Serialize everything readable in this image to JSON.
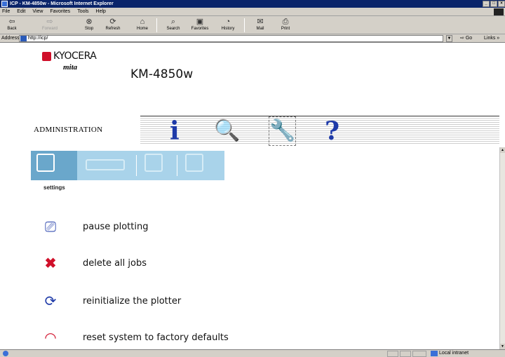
{
  "window": {
    "title": "ICP - KM-4850w - Microsoft Internet Explorer"
  },
  "menu": [
    "File",
    "Edit",
    "View",
    "Favorites",
    "Tools",
    "Help"
  ],
  "toolbar": {
    "back": "Back",
    "forward": "Forward",
    "stop": "Stop",
    "refresh": "Refresh",
    "home": "Home",
    "search": "Search",
    "favorites": "Favorites",
    "history": "History",
    "mail": "Mail",
    "print": "Print"
  },
  "address": {
    "label": "Address",
    "url": "http://icp/",
    "go": "Go",
    "links": "Links"
  },
  "brand": {
    "name": "KYOCERA",
    "sub": "mita",
    "model": "KM-4850w"
  },
  "section": {
    "title": "ADMINISTRATION"
  },
  "nav_icons": [
    {
      "glyph": "i",
      "name": "info-icon"
    },
    {
      "glyph": "🔍",
      "name": "search-tool-icon"
    },
    {
      "glyph": "🔧",
      "name": "wrench-icon"
    },
    {
      "glyph": "?",
      "name": "help-icon"
    }
  ],
  "subnav": {
    "active_label": "settings"
  },
  "actions": [
    {
      "label": "pause plotting",
      "icon": "pause-plot-icon"
    },
    {
      "label": "delete all jobs",
      "icon": "delete-jobs-icon"
    },
    {
      "label": "reinitialize the plotter",
      "icon": "reinitialize-icon"
    },
    {
      "label": "reset system to factory defaults",
      "icon": "reset-icon"
    }
  ],
  "status": {
    "zone": "Local intranet"
  },
  "colors": {
    "nav_icon": "#1e3aa8",
    "subnav_bg": "#a9d3ea",
    "subnav_active": "#6aa7cb",
    "logo_red": "#d0102a"
  }
}
